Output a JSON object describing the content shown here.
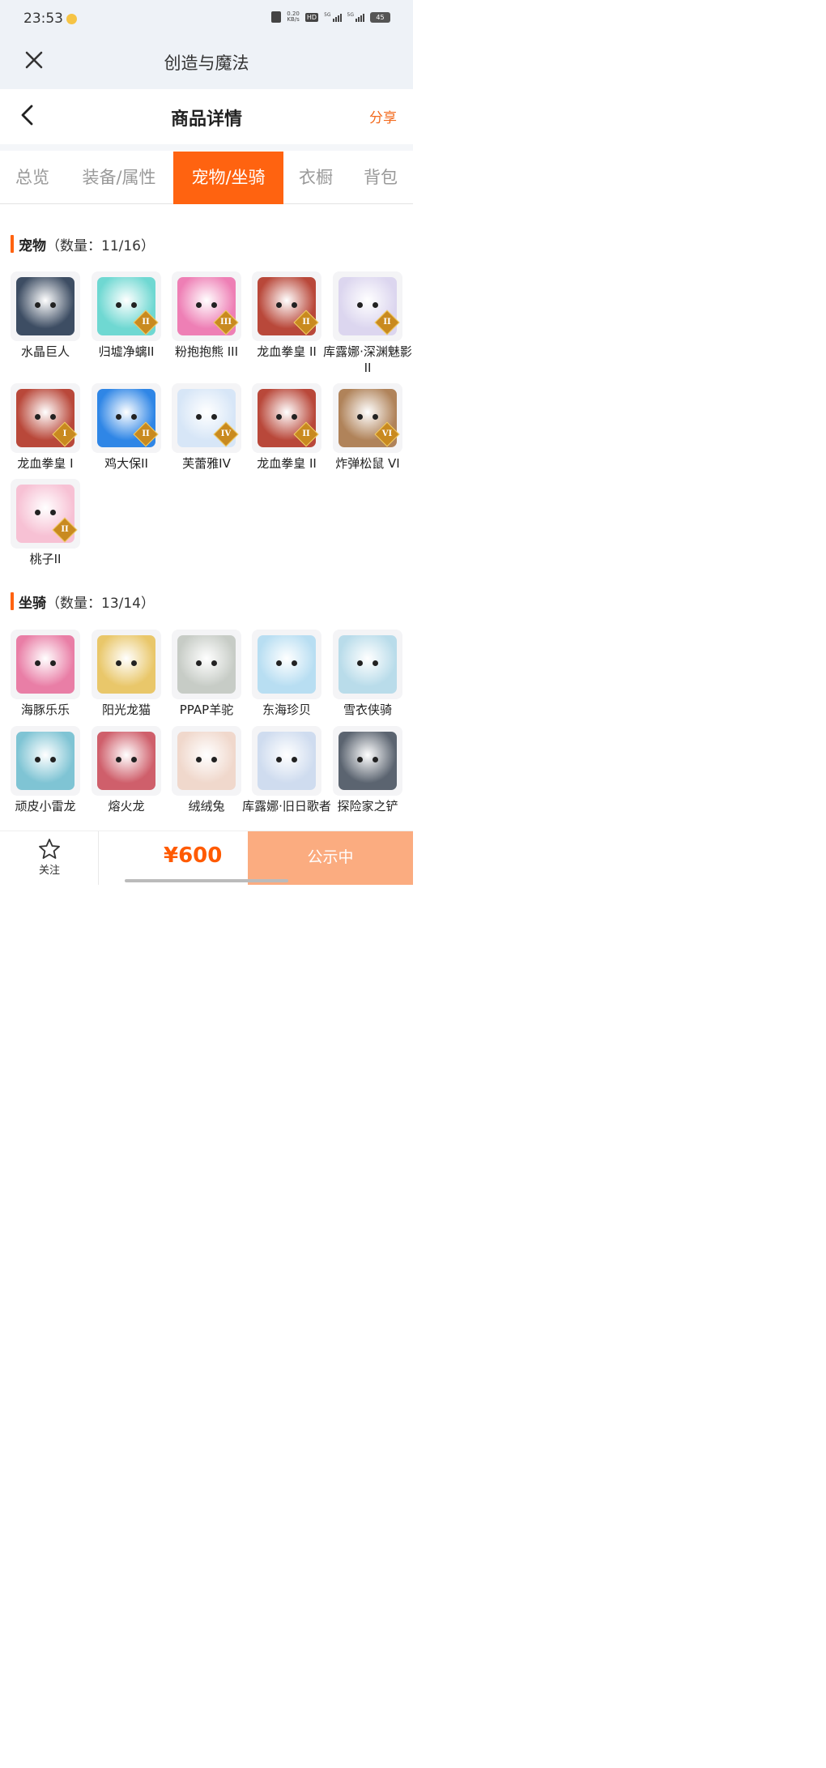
{
  "status_bar": {
    "time": "23:53",
    "speed_value": "0.20",
    "speed_unit": "KB/s",
    "hd_label": "HD",
    "network_1": "5G",
    "network_2": "5G",
    "battery": "45"
  },
  "app": {
    "title": "创造与魔法"
  },
  "header": {
    "title": "商品详情",
    "share_label": "分享"
  },
  "tabs": [
    {
      "label": "总览"
    },
    {
      "label": "装备/属性"
    },
    {
      "label": "宠物/坐骑"
    },
    {
      "label": "衣橱"
    },
    {
      "label": "背包"
    }
  ],
  "active_tab": "宠物/坐骑",
  "pets": {
    "title": "宠物",
    "count": "（数量：11/16）",
    "items": [
      {
        "name": "水晶巨人",
        "badge": "",
        "icon": "crystal-giant-icon",
        "color": "#3d4d63"
      },
      {
        "name": "归墟净螭II",
        "badge": "II",
        "icon": "jade-dragon-icon",
        "color": "#6fd8d2"
      },
      {
        "name": "粉抱抱熊 III",
        "badge": "III",
        "icon": "pink-bear-icon",
        "color": "#ee7fb5"
      },
      {
        "name": "龙血拳皇 II",
        "badge": "II",
        "icon": "ram-beast-icon",
        "color": "#b9483a"
      },
      {
        "name": "库露娜·深渊魅影II",
        "badge": "II",
        "icon": "abyss-girl-icon",
        "color": "#dcd6ef"
      },
      {
        "name": "龙血拳皇 I",
        "badge": "I",
        "icon": "ram-beast-icon",
        "color": "#b9483a"
      },
      {
        "name": "鸡大保II",
        "badge": "II",
        "icon": "blue-bird-icon",
        "color": "#2f86e6"
      },
      {
        "name": "芙蕾雅IV",
        "badge": "IV",
        "icon": "freya-icon",
        "color": "#d7e6f7"
      },
      {
        "name": "龙血拳皇 II",
        "badge": "II",
        "icon": "ram-beast-icon",
        "color": "#b9483a"
      },
      {
        "name": "炸弹松鼠 VI",
        "badge": "VI",
        "icon": "bomb-squirrel-icon",
        "color": "#b0835a"
      },
      {
        "name": "桃子II",
        "badge": "II",
        "icon": "white-cat-icon",
        "color": "#f7c1d4"
      }
    ]
  },
  "mounts": {
    "title": "坐骑",
    "count": "（数量：13/14）",
    "items": [
      {
        "name": "海豚乐乐",
        "icon": "pink-dolphin-icon",
        "color": "#e97ea6"
      },
      {
        "name": "阳光龙猫",
        "icon": "sun-totoro-icon",
        "color": "#e9c76a"
      },
      {
        "name": "PPAP羊驼",
        "icon": "alpaca-icon",
        "color": "#c7ccc6"
      },
      {
        "name": "东海珍贝",
        "icon": "pearl-shell-icon",
        "color": "#b8def2"
      },
      {
        "name": "雪衣侠骑",
        "icon": "white-horse-icon",
        "color": "#b9dcea"
      },
      {
        "name": "顽皮小雷龙",
        "icon": "baby-dragon-icon",
        "color": "#7fc4d4"
      },
      {
        "name": "熔火龙",
        "icon": "lava-dragon-icon",
        "color": "#cf5f6b"
      },
      {
        "name": "绒绒兔",
        "icon": "fluffy-rabbit-icon",
        "color": "#f0d8cc"
      },
      {
        "name": "库露娜·旧日歌者",
        "icon": "singer-girl-icon",
        "color": "#cfdcef"
      },
      {
        "name": "探险家之铲",
        "icon": "shovel-icon",
        "color": "#5b6470"
      }
    ]
  },
  "bottom": {
    "follow_label": "关注",
    "price": "¥600",
    "status_label": "公示中"
  },
  "colors": {
    "accent": "#ff6310",
    "price": "#ff5a00",
    "cta": "#fbac80"
  }
}
